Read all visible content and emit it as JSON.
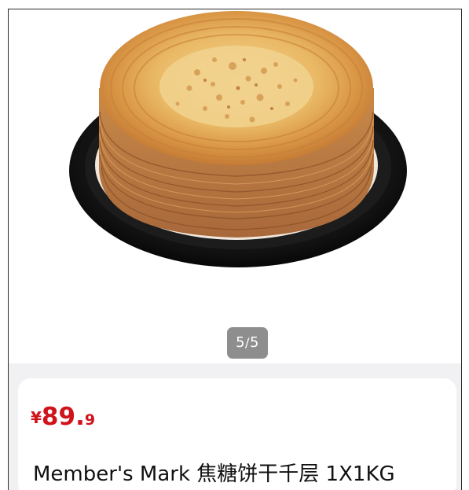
{
  "gallery": {
    "image_subject": "caramel-mille-crepe-cake",
    "current_page": "5",
    "total_pages": "5",
    "separator": "/"
  },
  "product": {
    "currency": "¥",
    "price_integer": "89",
    "price_dot": ".",
    "price_decimal": "9",
    "title": "Member's Mark 焦糖饼干千层 1X1KG"
  },
  "colors": {
    "price": "#d0121b",
    "indicator_bg": "#8e8e8e",
    "info_bg": "#f1f1f3"
  }
}
